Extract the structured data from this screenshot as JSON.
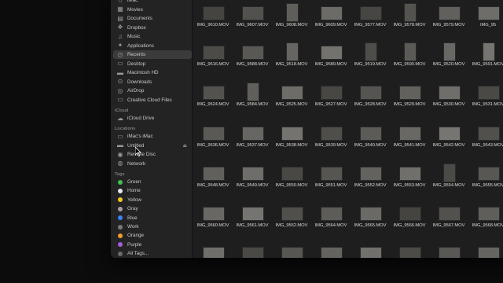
{
  "sidebar": {
    "favorites": [
      {
        "label": "iMac",
        "icon": "house-icon"
      },
      {
        "label": "Movies",
        "icon": "film-icon"
      },
      {
        "label": "Documents",
        "icon": "document-icon"
      },
      {
        "label": "Dropbox",
        "icon": "dropbox-icon"
      },
      {
        "label": "Music",
        "icon": "music-note-icon"
      },
      {
        "label": "Applications",
        "icon": "applications-icon"
      },
      {
        "label": "Recents",
        "icon": "clock-icon",
        "selected": true
      },
      {
        "label": "Desktop",
        "icon": "desktop-icon"
      },
      {
        "label": "Macintosh HD",
        "icon": "hard-drive-icon"
      },
      {
        "label": "Downloads",
        "icon": "download-icon"
      },
      {
        "label": "AirDrop",
        "icon": "airdrop-icon"
      },
      {
        "label": "Creative Cloud Files",
        "icon": "folder-icon"
      }
    ],
    "icloud_header": "iCloud",
    "icloud": [
      {
        "label": "iCloud Drive",
        "icon": "cloud-icon"
      }
    ],
    "locations_header": "Locations",
    "locations": [
      {
        "label": "iMac's iMac",
        "icon": "computer-icon"
      },
      {
        "label": "Untitled",
        "icon": "disk-icon",
        "eject": true
      },
      {
        "label": "Remote Disc",
        "icon": "optical-disc-icon"
      },
      {
        "label": "Network",
        "icon": "network-icon"
      }
    ],
    "tags_header": "Tags",
    "tags": [
      {
        "label": "Green",
        "color": "#3fbf4f"
      },
      {
        "label": "Home",
        "color": "#e8e8e8"
      },
      {
        "label": "Yellow",
        "color": "#f0c820"
      },
      {
        "label": "Gray",
        "color": "#a0a0a0"
      },
      {
        "label": "Blue",
        "color": "#3b82f6"
      },
      {
        "label": "Work",
        "color": "#7a7a7a"
      },
      {
        "label": "Orange",
        "color": "#f39c2a"
      },
      {
        "label": "Purple",
        "color": "#a35ed8"
      },
      {
        "label": "All Tags...",
        "color": "#6a6a6a"
      }
    ]
  },
  "files": {
    "rows": [
      [
        "IMG_9610.MOV",
        "IMG_9607.MOV",
        "IMG_9608.MOV",
        "IMG_9609.MOV",
        "IMG_9577.MOV",
        "IMG_9578.MOV",
        "IMG_9579.MOV",
        "IMG_95"
      ],
      [
        "IMG_9516.MOV",
        "IMG_9588.MOV",
        "IMG_9518.MOV",
        "IMG_9589.MOV",
        "IMG_9519.MOV",
        "IMG_9590.MOV",
        "IMG_9520.MOV",
        "IMG_9591.MOV"
      ],
      [
        "IMG_9524.MOV",
        "IMG_9584.MOV",
        "IMG_9525.MOV",
        "IMG_9527.MOV",
        "IMG_9528.MOV",
        "IMG_9529.MOV",
        "IMG_9530.MOV",
        "IMG_9531.MOV"
      ],
      [
        "IMG_9536.MOV",
        "IMG_9537.MOV",
        "IMG_9538.MOV",
        "IMG_9539.MOV",
        "IMG_9540.MOV",
        "IMG_9541.MOV",
        "IMG_9542.MOV",
        "IMG_9543.MOV"
      ],
      [
        "IMG_9548.MOV",
        "IMG_9549.MOV",
        "IMG_9550.MOV",
        "IMG_9551.MOV",
        "IMG_9552.MOV",
        "IMG_9553.MOV",
        "IMG_9554.MOV",
        "IMG_9555.MOV"
      ],
      [
        "IMG_9560.MOV",
        "IMG_9561.MOV",
        "IMG_9562.MOV",
        "IMG_9564.MOV",
        "IMG_9565.MOV",
        "IMG_9566.MOV",
        "IMG_9567.MOV",
        "IMG_9568.MOV"
      ],
      [
        "",
        "",
        "",
        "",
        "",
        "",
        "",
        ""
      ]
    ],
    "portrait_flags": [
      [
        0,
        0,
        1,
        0,
        0,
        1,
        0,
        0
      ],
      [
        0,
        0,
        1,
        0,
        1,
        1,
        1,
        1
      ],
      [
        0,
        1,
        0,
        0,
        0,
        0,
        0,
        0
      ],
      [
        0,
        0,
        0,
        0,
        0,
        0,
        0,
        0
      ],
      [
        0,
        0,
        0,
        0,
        0,
        0,
        1,
        0
      ],
      [
        0,
        0,
        0,
        0,
        0,
        0,
        0,
        0
      ],
      [
        0,
        0,
        0,
        0,
        0,
        0,
        0,
        0
      ]
    ]
  }
}
